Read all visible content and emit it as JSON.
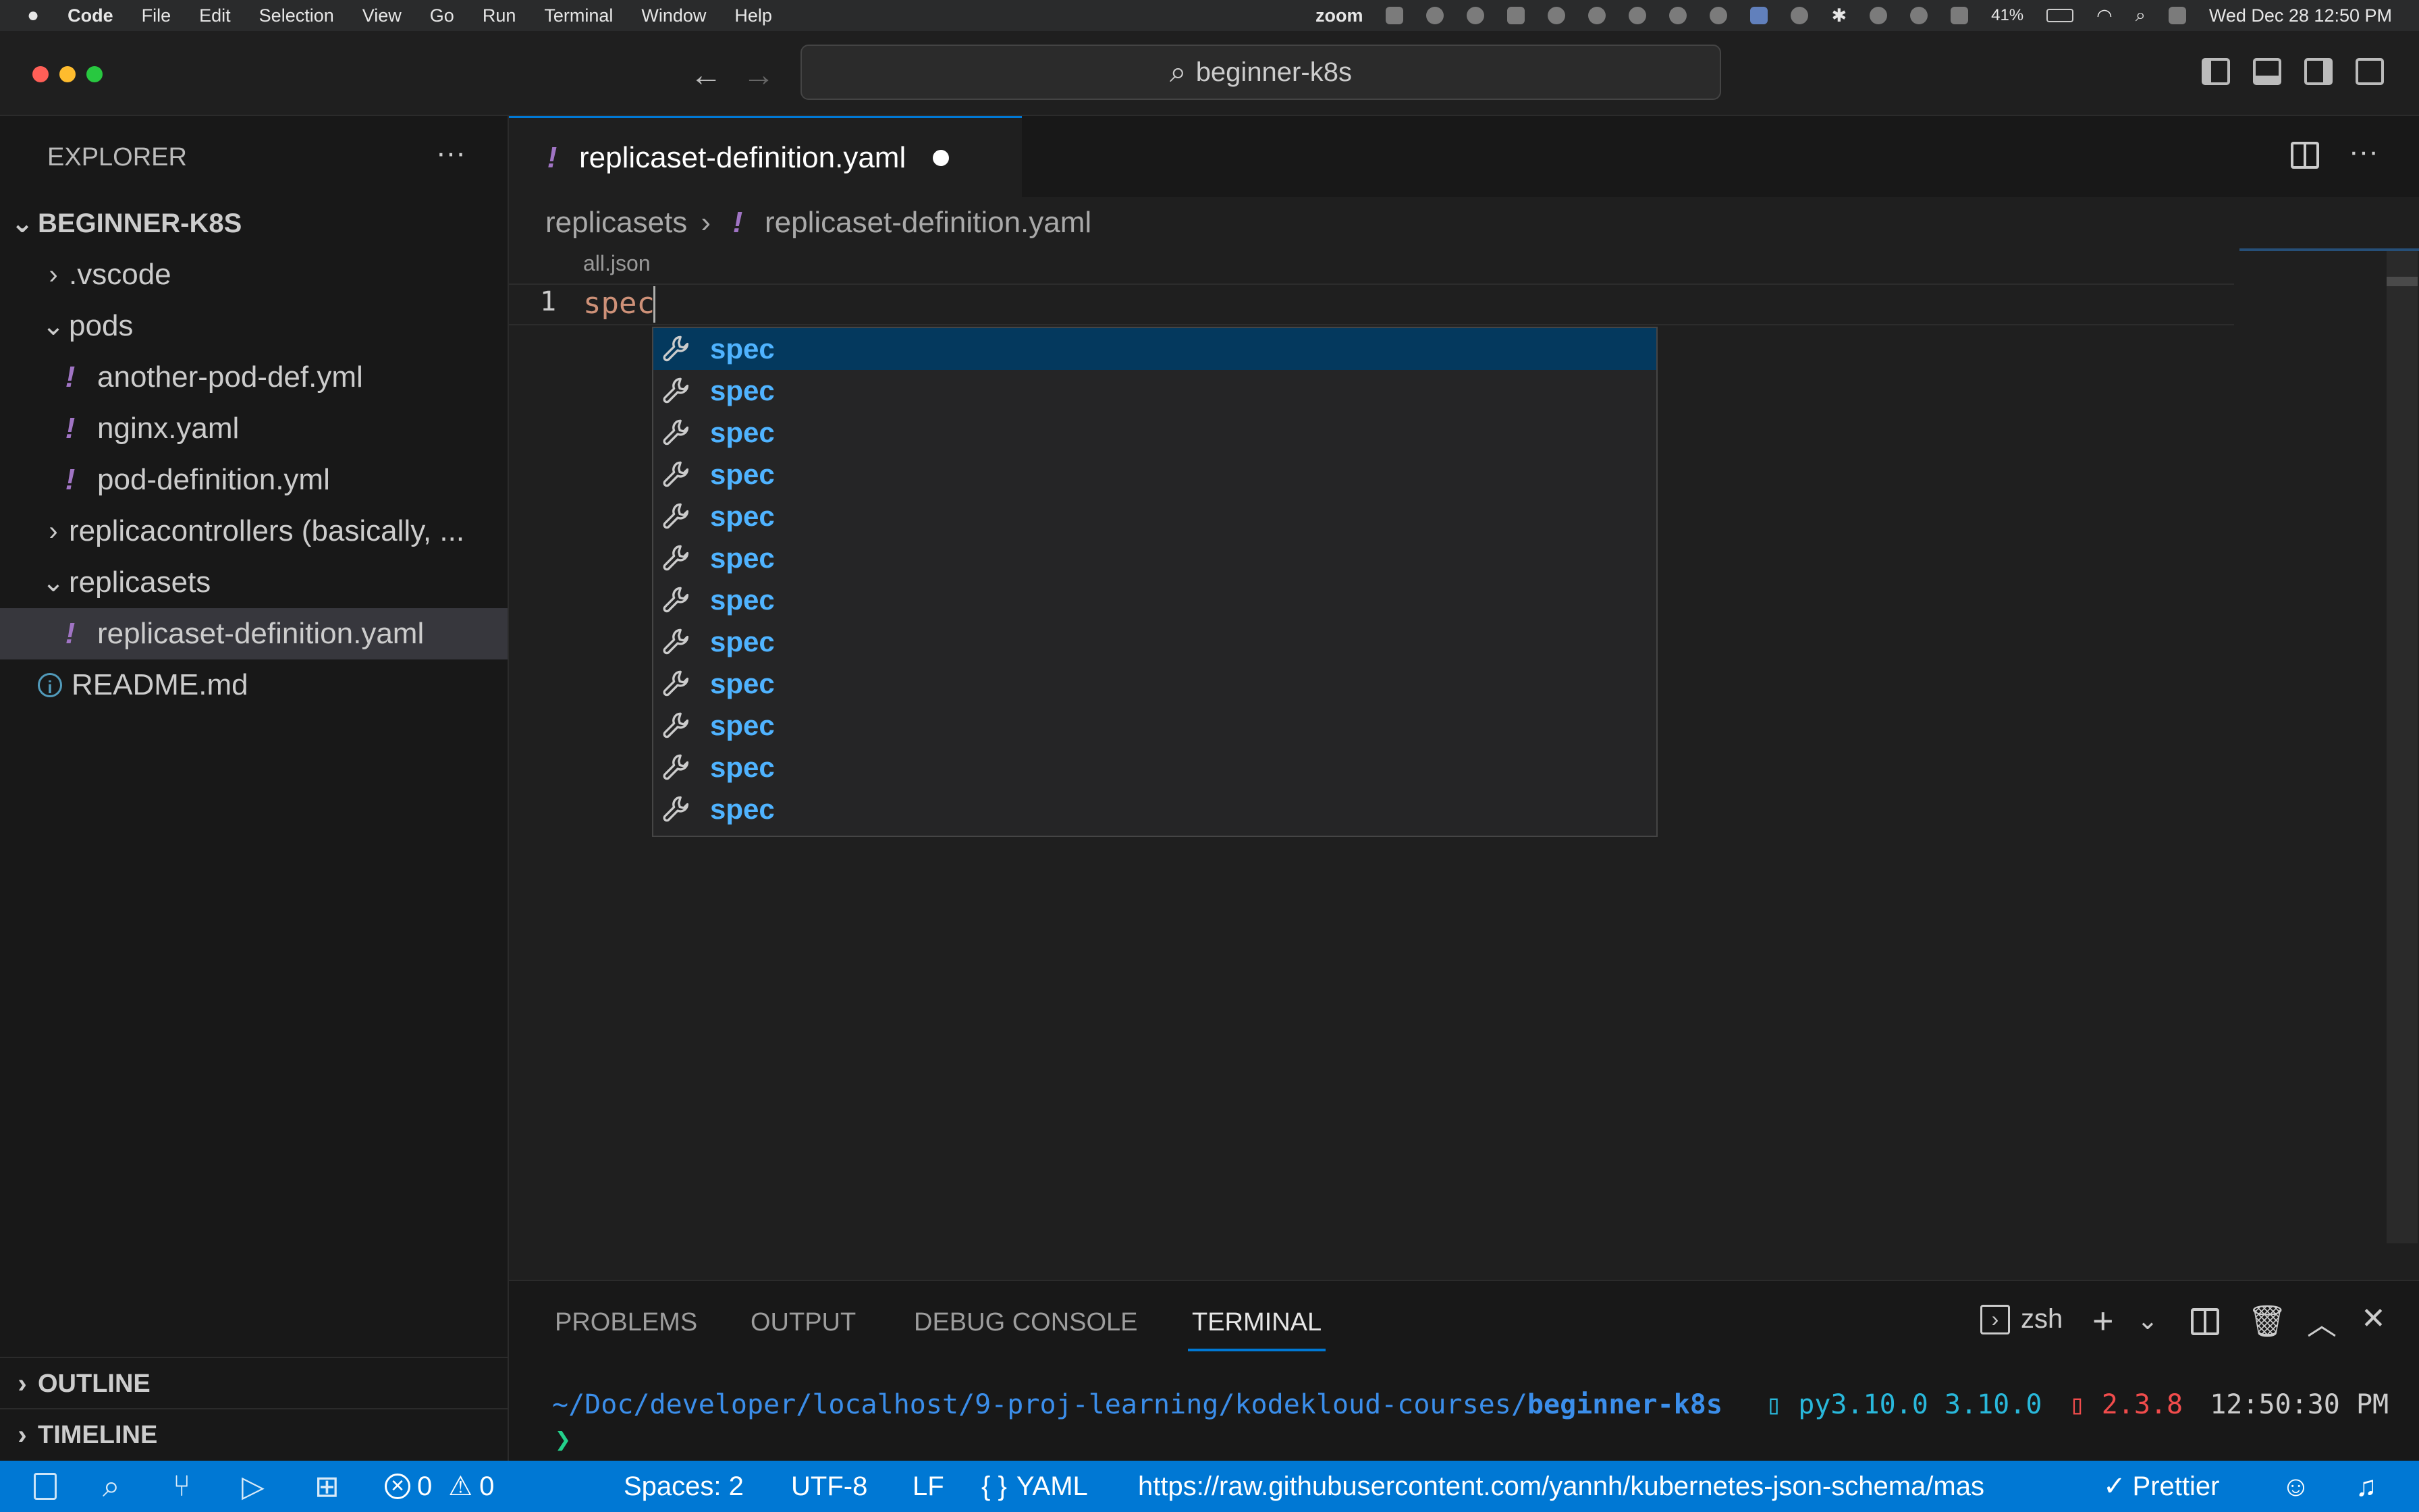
{
  "menubar": {
    "apple": "",
    "app": "Code",
    "items": [
      "File",
      "Edit",
      "Selection",
      "View",
      "Go",
      "Run",
      "Terminal",
      "Window",
      "Help"
    ],
    "zoom": "zoom",
    "battery": "41%",
    "datetime": "Wed Dec 28  12:50 PM"
  },
  "titlebar": {
    "search": "beginner-k8s"
  },
  "sidebar": {
    "title": "EXPLORER",
    "more": "···",
    "root": "BEGINNER-K8S",
    "tree": [
      {
        "label": ".vscode",
        "type": "folder-collapsed",
        "depth": 1
      },
      {
        "label": "pods",
        "type": "folder-open",
        "depth": 1
      },
      {
        "label": "another-pod-def.yml",
        "type": "yaml",
        "depth": 2
      },
      {
        "label": "nginx.yaml",
        "type": "yaml",
        "depth": 2
      },
      {
        "label": "pod-definition.yml",
        "type": "yaml",
        "depth": 2
      },
      {
        "label": "replicacontrollers (basically, ...",
        "type": "folder-collapsed",
        "depth": 1
      },
      {
        "label": "replicasets",
        "type": "folder-open",
        "depth": 1
      },
      {
        "label": "replicaset-definition.yaml",
        "type": "yaml",
        "depth": 2,
        "selected": true
      },
      {
        "label": "README.md",
        "type": "info",
        "depth": 1
      }
    ],
    "outline": "OUTLINE",
    "timeline": "TIMELINE"
  },
  "editor": {
    "tab_label": "replicaset-definition.yaml",
    "breadcrumb_folder": "replicasets",
    "breadcrumb_file": "replicaset-definition.yaml",
    "codelens": "all.json",
    "line_number": "1",
    "code": "spec",
    "suggestions": [
      "spec",
      "spec",
      "spec",
      "spec",
      "spec",
      "spec",
      "spec",
      "spec",
      "spec",
      "spec",
      "spec",
      "spec"
    ]
  },
  "panel": {
    "tabs": [
      "PROBLEMS",
      "OUTPUT",
      "DEBUG CONSOLE",
      "TERMINAL"
    ],
    "shell": "zsh",
    "terminal": {
      "path_prefix": "~/Doc/developer/localhost/9-proj-learning/kodekloud-courses/",
      "path_dir": "beginner-k8s",
      "py": "py3.10.0 3.10.0",
      "version": "2.3.8",
      "time": "12:50:30 PM",
      "prompt": "❯"
    }
  },
  "statusbar": {
    "errors": "0",
    "warnings": "0",
    "spaces": "Spaces: 2",
    "encoding": "UTF-8",
    "eol": "LF",
    "language": "YAML",
    "schema": "https://raw.githubusercontent.com/yannh/kubernetes-json-schema/mas",
    "prettier": "Prettier"
  }
}
